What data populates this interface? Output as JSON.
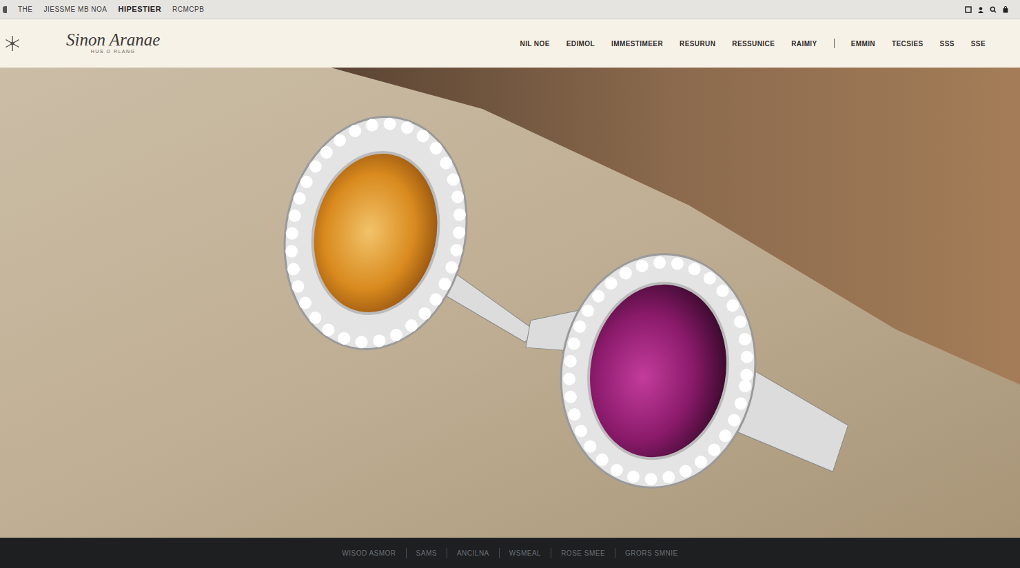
{
  "top_bar": {
    "items": [
      "THE",
      "JIESSME MB NOA",
      "HIPESTIER",
      "RCMCPB"
    ]
  },
  "logo": {
    "script": "Sinon Aranae",
    "tagline": "HUS O RLANG"
  },
  "nav": {
    "primary": [
      "NIL NOE",
      "EDIMOL",
      "IMMESTIMEER",
      "RESURUN",
      "RESSUNICE",
      "RAIMIY"
    ],
    "secondary": [
      "EMMIN",
      "TECSIES",
      "SSS",
      "SSE"
    ]
  },
  "footer": {
    "items": [
      "WISOD ASMOR",
      "SAMS",
      "ANCILNA",
      "WSMEAL",
      "ROSE SMEE",
      "GRORS SMNIE"
    ]
  }
}
